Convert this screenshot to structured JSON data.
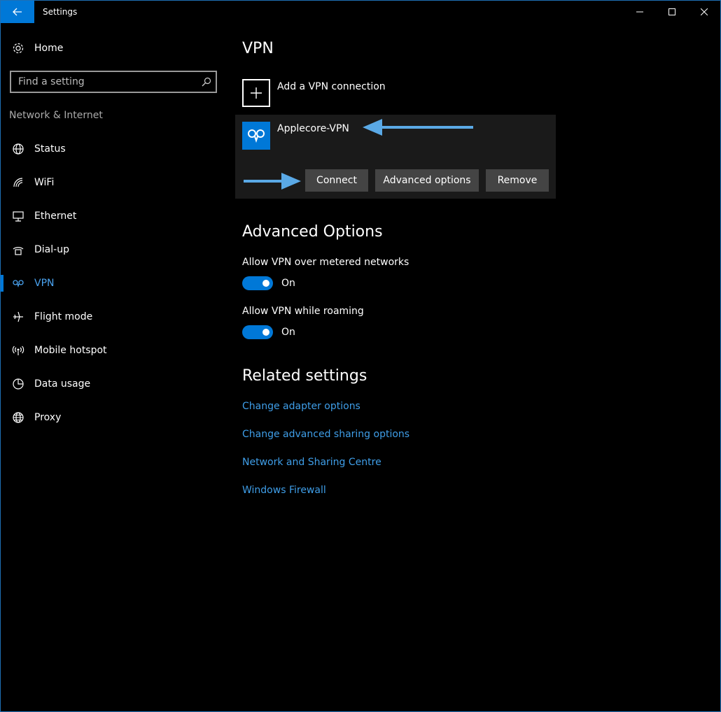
{
  "titlebar": {
    "title": "Settings"
  },
  "sidebar": {
    "home_label": "Home",
    "search_placeholder": "Find a setting",
    "section_label": "Network & Internet",
    "items": [
      {
        "label": "Status",
        "icon": "globe-icon"
      },
      {
        "label": "WiFi",
        "icon": "wifi-icon"
      },
      {
        "label": "Ethernet",
        "icon": "ethernet-icon"
      },
      {
        "label": "Dial-up",
        "icon": "dialup-icon"
      },
      {
        "label": "VPN",
        "icon": "vpn-icon",
        "active": true
      },
      {
        "label": "Flight mode",
        "icon": "airplane-icon"
      },
      {
        "label": "Mobile hotspot",
        "icon": "hotspot-icon"
      },
      {
        "label": "Data usage",
        "icon": "pie-chart-icon"
      },
      {
        "label": "Proxy",
        "icon": "globe-icon"
      }
    ]
  },
  "main": {
    "title": "VPN",
    "add_vpn_label": "Add a VPN connection",
    "vpn_connection": {
      "name": "Applecore-VPN",
      "buttons": {
        "connect": "Connect",
        "advanced": "Advanced options",
        "remove": "Remove"
      }
    },
    "advanced_options": {
      "heading": "Advanced Options",
      "metered": {
        "label": "Allow VPN over metered networks",
        "state": "On"
      },
      "roaming": {
        "label": "Allow VPN while roaming",
        "state": "On"
      }
    },
    "related": {
      "heading": "Related settings",
      "links": [
        "Change adapter options",
        "Change advanced sharing options",
        "Network and Sharing Centre",
        "Windows Firewall"
      ]
    }
  },
  "colors": {
    "accent": "#0078d7",
    "link": "#3f9ee8",
    "arrow": "#5aa9e6"
  }
}
